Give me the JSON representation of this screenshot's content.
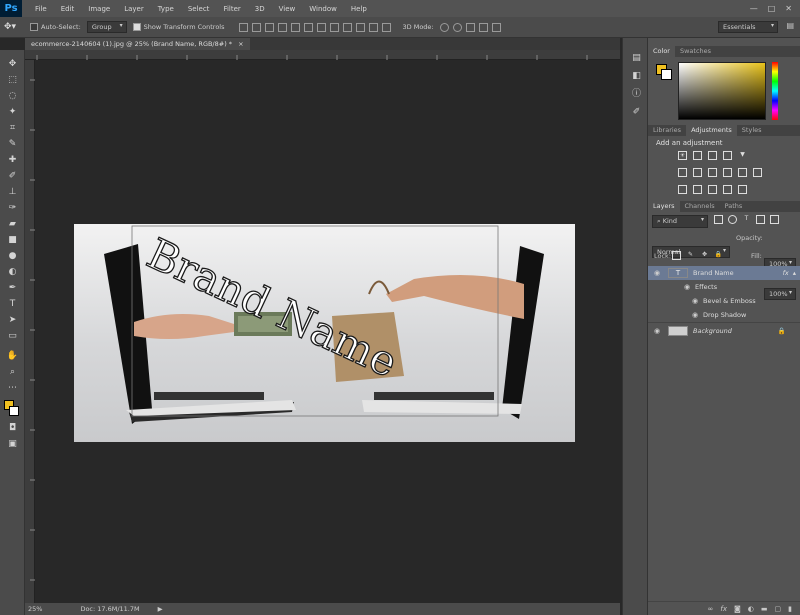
{
  "app": {
    "logo": "Ps"
  },
  "menu": [
    "File",
    "Edit",
    "Image",
    "Layer",
    "Type",
    "Select",
    "Filter",
    "3D",
    "View",
    "Window",
    "Help"
  ],
  "window_controls": [
    "—",
    "□",
    "✕"
  ],
  "options": {
    "auto_select_label": "Auto-Select:",
    "auto_select_value": "Group",
    "transform_label": "Show Transform Controls",
    "mode_3d": "3D Mode:",
    "workspace": "Essentials"
  },
  "document": {
    "tab_title": "ecommerce-2140604 (1).jpg @ 25% (Brand Name, RGB/8#) *",
    "close": "×",
    "text_layer": "Brand Name"
  },
  "status": {
    "zoom": "25%",
    "doc_size": "Doc: 17.6M/11.7M",
    "arrow": "▶"
  },
  "panels": {
    "color_tabs": [
      "Color",
      "Swatches"
    ],
    "adj_tabs": [
      "Libraries",
      "Adjustments",
      "Styles"
    ],
    "adj_title": "Add an adjustment",
    "layers_tabs": [
      "Layers",
      "Channels",
      "Paths"
    ],
    "kind": "Kind",
    "blend_mode": "Normal",
    "opacity_label": "Opacity:",
    "opacity": "100%",
    "lock_label": "Lock:",
    "fill_label": "Fill:",
    "fill": "100%",
    "layers": [
      {
        "name": "Brand Name",
        "type": "text",
        "fx": "fx"
      },
      {
        "name": "Effects",
        "type": "effects"
      },
      {
        "name": "Bevel & Emboss",
        "type": "effect"
      },
      {
        "name": "Drop Shadow",
        "type": "effect"
      },
      {
        "name": "Background",
        "type": "image"
      }
    ]
  },
  "colors": {
    "foreground": "#f0c020",
    "background": "#ffffff",
    "ui_dark": "#282828",
    "ui_panel": "#535353"
  }
}
